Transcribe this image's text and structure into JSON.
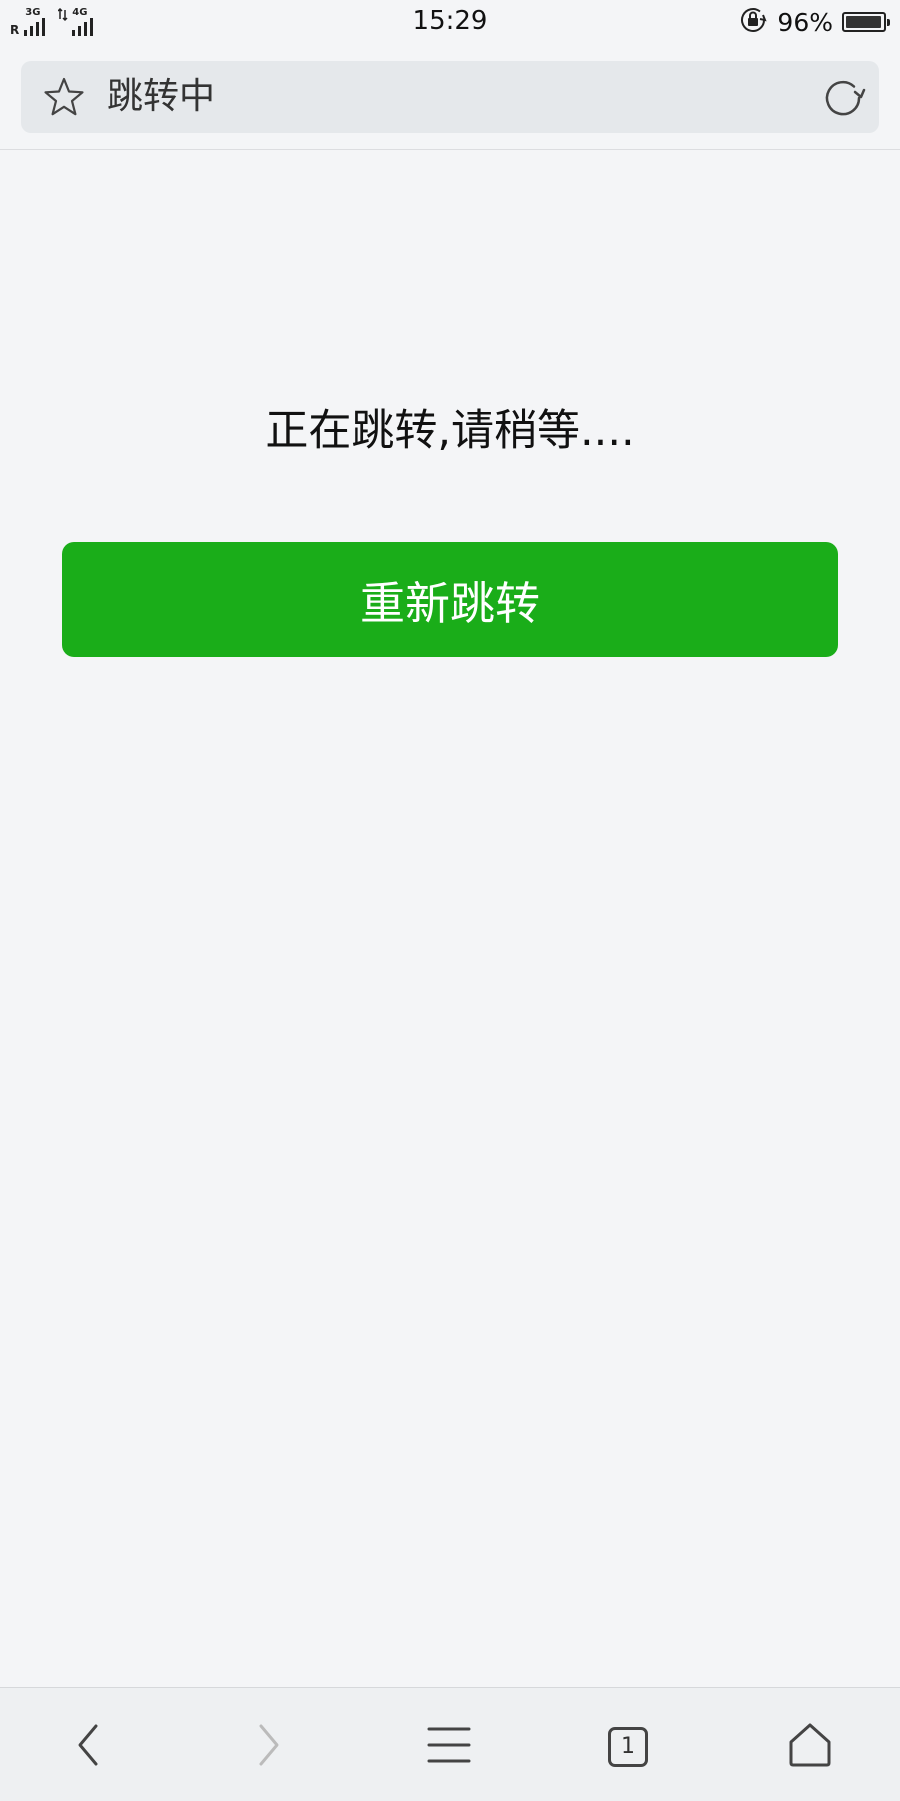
{
  "status_bar": {
    "roaming": "R",
    "network1": "3G",
    "network2": "4G",
    "time": "15:29",
    "battery_percent": "96%",
    "battery_level": 0.96,
    "icons": [
      "signal-icon",
      "orientation-lock-icon",
      "battery-icon"
    ]
  },
  "address_bar": {
    "title": "跳转中",
    "icons": [
      "star-icon",
      "refresh-icon"
    ]
  },
  "main": {
    "message": "正在跳转,请稍等....",
    "button_label": "重新跳转",
    "button_color": "#1aad19"
  },
  "bottom_nav": {
    "tab_count": "1",
    "icons": [
      "back-icon",
      "forward-icon",
      "menu-icon",
      "tabs-icon",
      "home-icon"
    ]
  },
  "colors": {
    "background": "#f4f5f7",
    "address_bar": "#e5e8eb",
    "accent": "#1aad19"
  }
}
